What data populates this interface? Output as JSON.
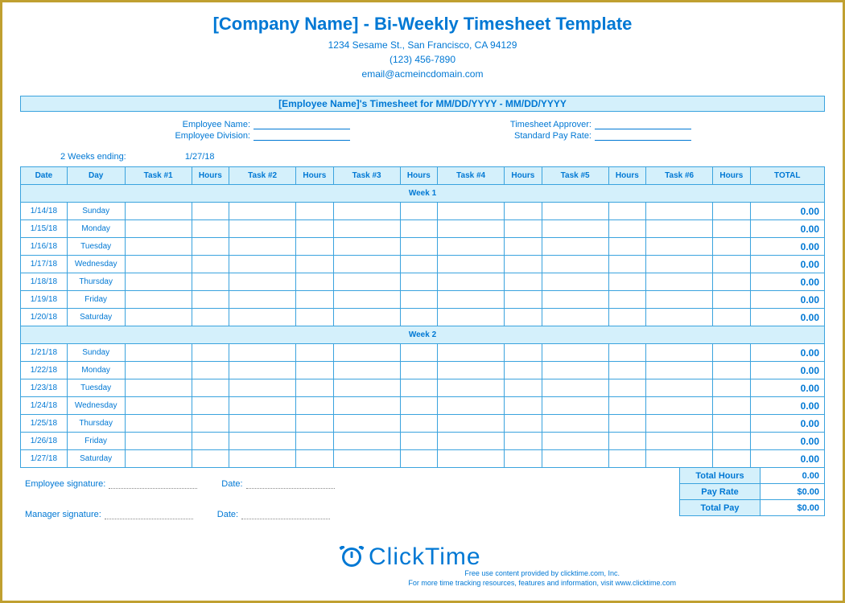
{
  "header": {
    "title": "[Company Name] - Bi-Weekly Timesheet Template",
    "address1": "1234 Sesame St.,  San Francisco, CA 94129",
    "phone": "(123) 456-7890",
    "email": "email@acmeincdomain.com"
  },
  "subheader": "[Employee Name]'s Timesheet for MM/DD/YYYY - MM/DD/YYYY",
  "fields": {
    "emp_name_label": "Employee Name:",
    "emp_div_label": "Employee Division:",
    "approver_label": "Timesheet Approver:",
    "payrate_label": "Standard Pay Rate:"
  },
  "period": {
    "label": "2 Weeks ending:",
    "value": "1/27/18"
  },
  "columns": [
    "Date",
    "Day",
    "Task #1",
    "Hours",
    "Task #2",
    "Hours",
    "Task #3",
    "Hours",
    "Task #4",
    "Hours",
    "Task #5",
    "Hours",
    "Task #6",
    "Hours",
    "TOTAL"
  ],
  "sep1": "Week 1",
  "sep2": "Week 2",
  "week1": [
    {
      "date": "1/14/18",
      "day": "Sunday",
      "total": "0.00"
    },
    {
      "date": "1/15/18",
      "day": "Monday",
      "total": "0.00"
    },
    {
      "date": "1/16/18",
      "day": "Tuesday",
      "total": "0.00"
    },
    {
      "date": "1/17/18",
      "day": "Wednesday",
      "total": "0.00"
    },
    {
      "date": "1/18/18",
      "day": "Thursday",
      "total": "0.00"
    },
    {
      "date": "1/19/18",
      "day": "Friday",
      "total": "0.00"
    },
    {
      "date": "1/20/18",
      "day": "Saturday",
      "total": "0.00"
    }
  ],
  "week2": [
    {
      "date": "1/21/18",
      "day": "Sunday",
      "total": "0.00"
    },
    {
      "date": "1/22/18",
      "day": "Monday",
      "total": "0.00"
    },
    {
      "date": "1/23/18",
      "day": "Tuesday",
      "total": "0.00"
    },
    {
      "date": "1/24/18",
      "day": "Wednesday",
      "total": "0.00"
    },
    {
      "date": "1/25/18",
      "day": "Thursday",
      "total": "0.00"
    },
    {
      "date": "1/26/18",
      "day": "Friday",
      "total": "0.00"
    },
    {
      "date": "1/27/18",
      "day": "Saturday",
      "total": "0.00"
    }
  ],
  "summary": {
    "total_hours_label": "Total Hours",
    "total_hours": "0.00",
    "pay_rate_label": "Pay Rate",
    "pay_rate": "$0.00",
    "total_pay_label": "Total Pay",
    "total_pay": "$0.00"
  },
  "signatures": {
    "emp": "Employee signature:",
    "mgr": "Manager signature:",
    "date": "Date:"
  },
  "logo": "ClickTime",
  "footer": {
    "l1": "Free use content provided by clicktime.com, Inc.",
    "l2": "For more time tracking resources, features and information, visit www.clicktime.com"
  }
}
